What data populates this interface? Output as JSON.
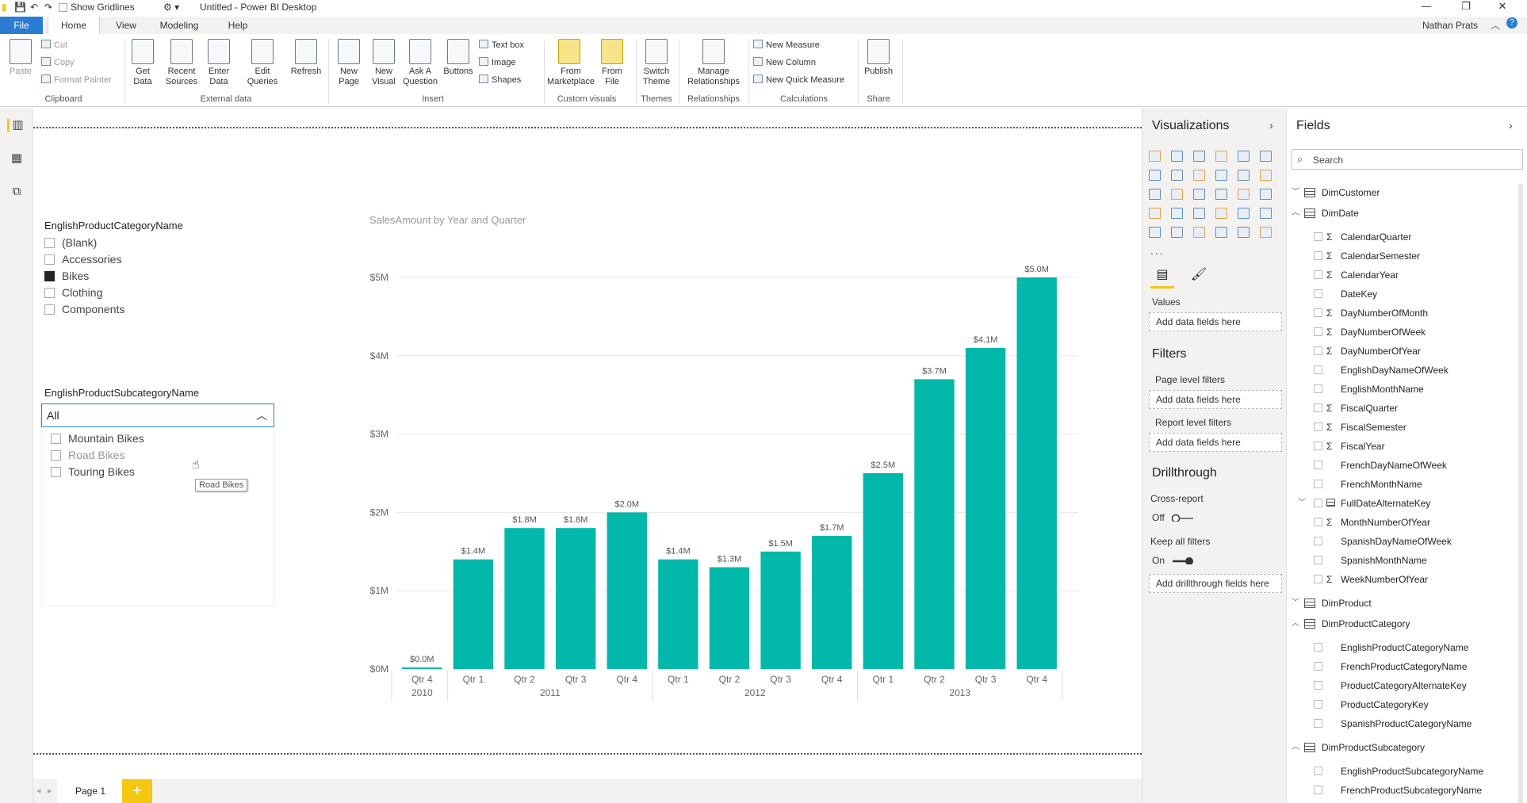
{
  "titlebar": {
    "show_gridlines": "Show Gridlines",
    "title": "Untitled - Power BI Desktop"
  },
  "tabs": [
    "File",
    "Home",
    "View",
    "Modeling",
    "Help"
  ],
  "user": "Nathan Prats",
  "ribbon": {
    "clipboard": {
      "paste": "Paste",
      "cut": "Cut",
      "copy": "Copy",
      "format_painter": "Format Painter",
      "label": "Clipboard"
    },
    "external_data": {
      "get_data": "Get Data",
      "recent_sources": "Recent Sources",
      "enter_data": "Enter Data",
      "edit_queries": "Edit Queries",
      "refresh": "Refresh",
      "label": "External data"
    },
    "insert": {
      "new_page": "New Page",
      "new_visual": "New Visual",
      "ask_question": "Ask A Question",
      "buttons": "Buttons",
      "text_box": "Text box",
      "image": "Image",
      "shapes": "Shapes",
      "label": "Insert"
    },
    "custom_visuals": {
      "from_marketplace": "From Marketplace",
      "from_file": "From File",
      "label": "Custom visuals"
    },
    "themes": {
      "switch_theme": "Switch Theme",
      "label": "Themes"
    },
    "relationships": {
      "manage": "Manage Relationships",
      "label": "Relationships"
    },
    "calculations": {
      "new_measure": "New Measure",
      "new_column": "New Column",
      "new_quick_measure": "New Quick Measure",
      "label": "Calculations"
    },
    "share": {
      "publish": "Publish",
      "label": "Share"
    }
  },
  "slicer1": {
    "title": "EnglishProductCategoryName",
    "items": [
      {
        "label": "(Blank)",
        "checked": false
      },
      {
        "label": "Accessories",
        "checked": false
      },
      {
        "label": "Bikes",
        "checked": true
      },
      {
        "label": "Clothing",
        "checked": false
      },
      {
        "label": "Components",
        "checked": false
      }
    ]
  },
  "slicer2": {
    "title": "EnglishProductSubcategoryName",
    "dropdown_value": "All",
    "items": [
      "Mountain Bikes",
      "Road Bikes",
      "Touring Bikes"
    ],
    "tooltip": "Road Bikes"
  },
  "chart_data": {
    "type": "bar",
    "title": "SalesAmount by Year and Quarter",
    "categories": [
      "Qtr 4",
      "Qtr 1",
      "Qtr 2",
      "Qtr 3",
      "Qtr 4",
      "Qtr 1",
      "Qtr 2",
      "Qtr 3",
      "Qtr 4",
      "Qtr 1",
      "Qtr 2",
      "Qtr 3",
      "Qtr 4"
    ],
    "years": [
      {
        "label": "2010",
        "count": 1
      },
      {
        "label": "2011",
        "count": 4
      },
      {
        "label": "2012",
        "count": 4
      },
      {
        "label": "2013",
        "count": 4
      }
    ],
    "values": [
      0.02,
      1.4,
      1.8,
      1.8,
      2.0,
      1.4,
      1.3,
      1.5,
      1.7,
      2.5,
      3.7,
      4.1,
      5.0
    ],
    "data_labels": [
      "$0.0M",
      "$1.4M",
      "$1.8M",
      "$1.8M",
      "$2.0M",
      "$1.4M",
      "$1.3M",
      "$1.5M",
      "$1.7M",
      "$2.5M",
      "$3.7M",
      "$4.1M",
      "$5.0M"
    ],
    "y_ticks": [
      "$0M",
      "$1M",
      "$2M",
      "$3M",
      "$4M",
      "$5M"
    ],
    "ylim": [
      0,
      5
    ],
    "bar_color": "#01b8aa",
    "grid": true
  },
  "visualizations": {
    "title": "Visualizations",
    "values_label": "Values",
    "add_fields": "Add data fields here",
    "filters_title": "Filters",
    "page_filters": "Page level filters",
    "report_filters": "Report level filters",
    "drillthrough_title": "Drillthrough",
    "cross_report": "Cross-report",
    "off": "Off",
    "keep_all_filters": "Keep all filters",
    "on": "On",
    "add_drillthrough": "Add drillthrough fields here"
  },
  "fields": {
    "title": "Fields",
    "search_placeholder": "Search",
    "tables": [
      {
        "name": "DimCustomer",
        "expanded": false,
        "fields": []
      },
      {
        "name": "DimDate",
        "expanded": true,
        "fields": [
          {
            "name": "CalendarQuarter",
            "sigma": true
          },
          {
            "name": "CalendarSemester",
            "sigma": true
          },
          {
            "name": "CalendarYear",
            "sigma": true
          },
          {
            "name": "DateKey",
            "sigma": false
          },
          {
            "name": "DayNumberOfMonth",
            "sigma": true
          },
          {
            "name": "DayNumberOfWeek",
            "sigma": true
          },
          {
            "name": "DayNumberOfYear",
            "sigma": true
          },
          {
            "name": "EnglishDayNameOfWeek",
            "sigma": false
          },
          {
            "name": "EnglishMonthName",
            "sigma": false
          },
          {
            "name": "FiscalQuarter",
            "sigma": true
          },
          {
            "name": "FiscalSemester",
            "sigma": true
          },
          {
            "name": "FiscalYear",
            "sigma": true
          },
          {
            "name": "FrenchDayNameOfWeek",
            "sigma": false
          },
          {
            "name": "FrenchMonthName",
            "sigma": false
          },
          {
            "name": "FullDateAlternateKey",
            "sigma": false,
            "hierarchy": true
          },
          {
            "name": "MonthNumberOfYear",
            "sigma": true
          },
          {
            "name": "SpanishDayNameOfWeek",
            "sigma": false
          },
          {
            "name": "SpanishMonthName",
            "sigma": false
          },
          {
            "name": "WeekNumberOfYear",
            "sigma": true
          }
        ]
      },
      {
        "name": "DimProduct",
        "expanded": false,
        "fields": []
      },
      {
        "name": "DimProductCategory",
        "expanded": true,
        "fields": [
          {
            "name": "EnglishProductCategoryName",
            "sigma": false
          },
          {
            "name": "FrenchProductCategoryName",
            "sigma": false
          },
          {
            "name": "ProductCategoryAlternateKey",
            "sigma": false
          },
          {
            "name": "ProductCategoryKey",
            "sigma": false
          },
          {
            "name": "SpanishProductCategoryName",
            "sigma": false
          }
        ]
      },
      {
        "name": "DimProductSubcategory",
        "expanded": true,
        "fields": [
          {
            "name": "EnglishProductSubcategoryName",
            "sigma": false
          },
          {
            "name": "FrenchProductSubcategoryName",
            "sigma": false
          }
        ]
      }
    ]
  },
  "pages": {
    "current": "Page 1",
    "add": "+"
  }
}
